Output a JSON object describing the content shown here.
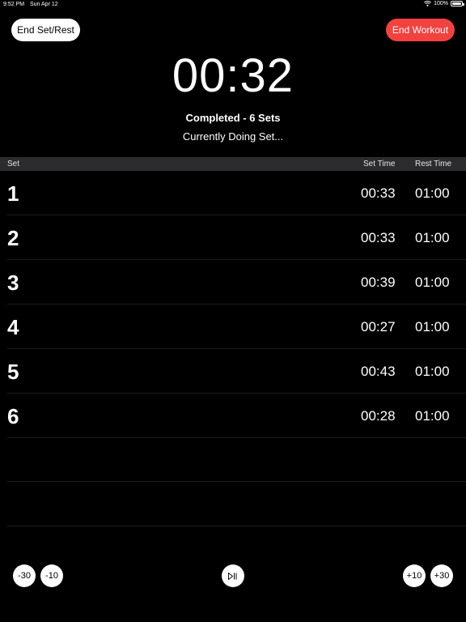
{
  "status_bar": {
    "time": "9:52 PM",
    "date": "Sun Apr 12",
    "battery": "100%"
  },
  "header": {
    "end_set_label": "End Set/Rest",
    "end_workout_label": "End Workout",
    "end_workout_color": "#f2423f"
  },
  "timer": {
    "value": "00:32",
    "completed": "Completed - 6 Sets",
    "status": "Currently Doing Set..."
  },
  "table": {
    "headers": {
      "set": "Set",
      "set_time": "Set Time",
      "rest_time": "Rest Time"
    },
    "rows": [
      {
        "set": "1",
        "set_time": "00:33",
        "rest_time": "01:00"
      },
      {
        "set": "2",
        "set_time": "00:33",
        "rest_time": "01:00"
      },
      {
        "set": "3",
        "set_time": "00:39",
        "rest_time": "01:00"
      },
      {
        "set": "4",
        "set_time": "00:27",
        "rest_time": "01:00"
      },
      {
        "set": "5",
        "set_time": "00:43",
        "rest_time": "01:00"
      },
      {
        "set": "6",
        "set_time": "00:28",
        "rest_time": "01:00"
      }
    ]
  },
  "controls": {
    "minus30": "-30",
    "minus10": "-10",
    "play_pause_icon": "play-pause-icon",
    "plus10": "+10",
    "plus30": "+30"
  }
}
